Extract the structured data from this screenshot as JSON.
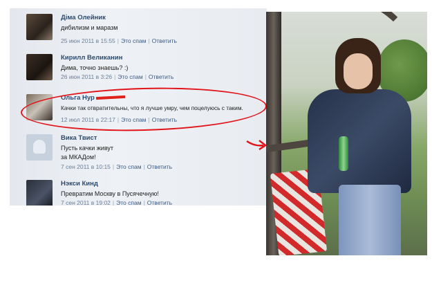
{
  "comments": [
    {
      "name": "Діма Олейник",
      "text": "дибилизм и маразм",
      "time": "25 июн 2011 в 15:55",
      "spam": "Это спам",
      "reply": "Ответить"
    },
    {
      "name": "Кирилл Великанин",
      "text": "Дима, точно знаешь? :)",
      "time": "26 июн 2011 в 3:26",
      "spam": "Это спам",
      "reply": "Ответить"
    },
    {
      "name": "Ольга Нур",
      "text": "Качки так отвратительны, что я лучше умру, чем поцелуюсь с таким.",
      "time": "12 июл 2011 в 22:17",
      "spam": "Это спам",
      "reply": "Ответить"
    },
    {
      "name": "Вика Твист",
      "text": "Пусть качки живут",
      "text2": "за МКАДом!",
      "time": "7 сен 2011 в 10:15",
      "spam": "Это спам",
      "reply": "Ответить"
    },
    {
      "name": "Нэкси Кинд",
      "text": "Превратим Москву в Пусячечную!",
      "time": "7 сен 2011 в 19:02",
      "spam": "Это спам",
      "reply": "Ответить"
    }
  ],
  "colors": {
    "highlight": "#e1141a",
    "name": "#2b4a6f",
    "link": "#3a5a85"
  }
}
